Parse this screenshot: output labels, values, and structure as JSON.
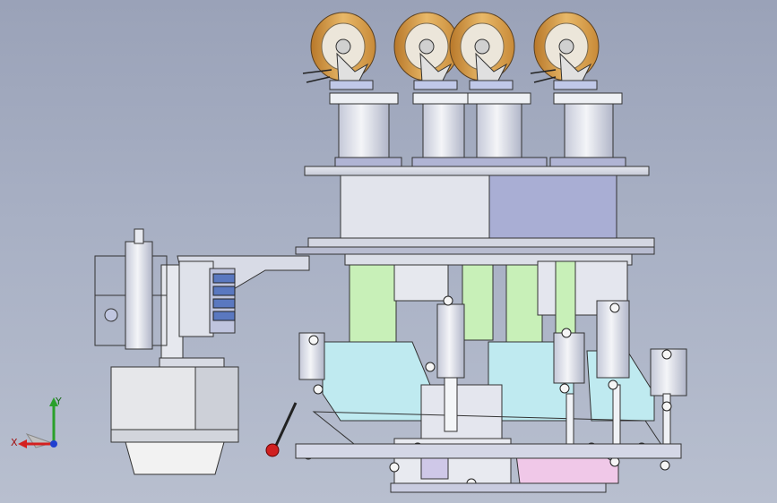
{
  "viewport": {
    "background_top": "#9aa2b8",
    "background_bottom": "#b8bfcf",
    "content": "cad-assembly-front-view"
  },
  "triad": {
    "x_label": "X",
    "y_label": "Y",
    "x_color": "#d42020",
    "y_color": "#2aa02a",
    "z_color": "#2040d0"
  },
  "colors": {
    "wheel_tread": "#d9a24a",
    "wheel_hub": "#e8e4dc",
    "steel": "#d8dbe4",
    "steel_dark": "#a9aec4",
    "purple_plate": "#b8b8e0",
    "green_block": "#c8f0b8",
    "cyan_block": "#bfeaf0",
    "pink_part": "#f0c8e8",
    "handle_ball": "#d02020"
  }
}
